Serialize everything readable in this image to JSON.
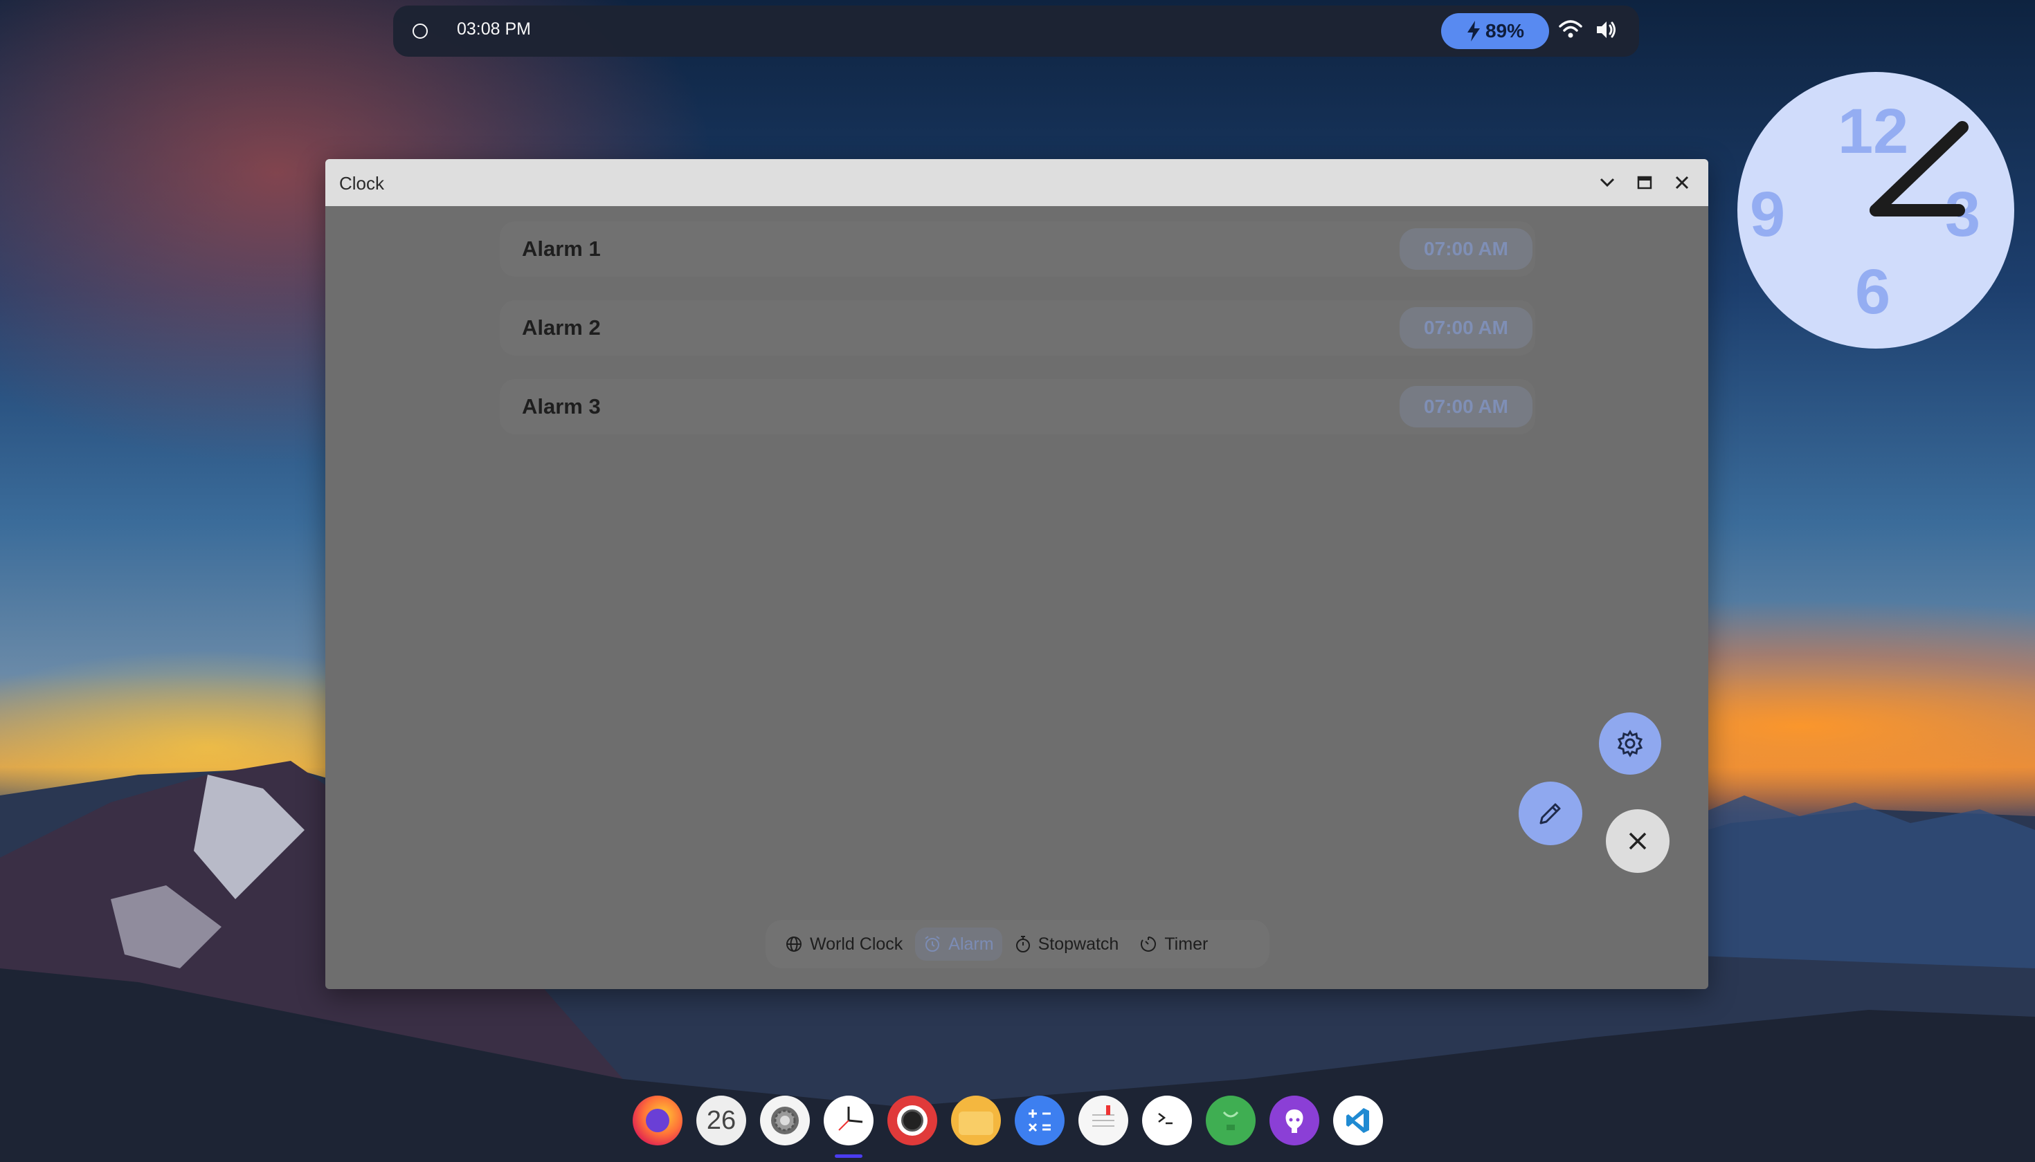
{
  "topbar": {
    "time": "03:08 PM",
    "battery_label": "89%"
  },
  "clock_widget": {
    "numbers": [
      "12",
      "3",
      "6",
      "9"
    ]
  },
  "window": {
    "title": "Clock",
    "alarms": [
      {
        "name": "Alarm 1",
        "time": "07:00 AM"
      },
      {
        "name": "Alarm 2",
        "time": "07:00 AM"
      },
      {
        "name": "Alarm 3",
        "time": "07:00 AM"
      }
    ],
    "tabs": [
      {
        "label": "World Clock",
        "icon": "globe-icon",
        "active": false
      },
      {
        "label": "Alarm",
        "icon": "alarm-icon",
        "active": true
      },
      {
        "label": "Stopwatch",
        "icon": "stopwatch-icon",
        "active": false
      },
      {
        "label": "Timer",
        "icon": "timer-icon",
        "active": false
      }
    ]
  },
  "dock": {
    "calendar_day": "26",
    "apps": [
      "firefox",
      "calendar",
      "settings",
      "clock",
      "screen-recorder",
      "files",
      "calculator",
      "notes",
      "terminal",
      "store",
      "github",
      "vscode"
    ]
  },
  "colors": {
    "accent": "#5b8ef7",
    "window_bg": "#6e6e6e",
    "titlebar": "#dedede"
  }
}
